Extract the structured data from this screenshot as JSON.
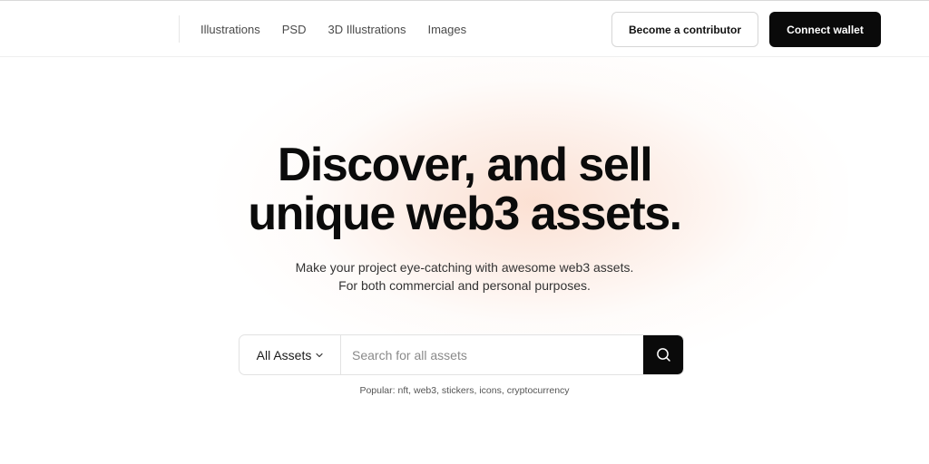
{
  "header": {
    "nav": [
      "Illustrations",
      "PSD",
      "3D Illustrations",
      "Images"
    ],
    "contributor_label": "Become a contributor",
    "wallet_label": "Connect wallet"
  },
  "hero": {
    "title_line1": "Discover, and sell",
    "title_line2": "unique web3 assets.",
    "subtitle_line1": "Make your project eye-catching with awesome web3 assets.",
    "subtitle_line2": "For both commercial and personal purposes."
  },
  "search": {
    "category": "All Assets",
    "placeholder": "Search for all assets",
    "popular": "Popular: nft, web3, stickers, icons, cryptocurrency"
  },
  "colors": {
    "accent_dark": "#0a0a0a",
    "glow": "#fad6c4"
  },
  "icons": {
    "search_button": "search-icon",
    "category_chevron": "chevron-down-icon"
  }
}
